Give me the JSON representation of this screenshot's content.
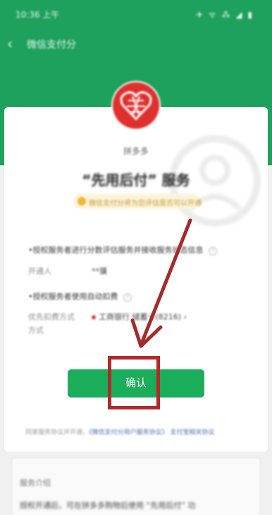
{
  "status_bar": {
    "time": "10:36 上午",
    "icons": "✈ ᯤ ⁂ ◢ ▮"
  },
  "nav": {
    "title": "微信支付分",
    "back_icon": "chevron-left-icon"
  },
  "merchant": {
    "name": "拼多多",
    "logo_icon": "heart-logo-icon"
  },
  "service": {
    "title": "“先用后付” 服务",
    "notice": "微信支付分将为您评估是否可以开通"
  },
  "authorizations": [
    {
      "title": "•授权服务者进行分数评估服务并接收服务状态信息",
      "detail_label": "开通人",
      "detail_value": "**骥"
    },
    {
      "title": "•授权服务者使用自动扣费",
      "detail_label": "优先扣费方式",
      "detail_value": "工商银行 储蓄卡(8216)",
      "detail_extra": "方式"
    }
  ],
  "confirm_button": {
    "label": "确认"
  },
  "agreement": {
    "prefix": "同意服务协议并开通，",
    "link1": "《微信支付分用户服务协议》",
    "link2": "支付宝相关协议"
  },
  "intro": {
    "title": "服务介绍",
    "text": "授权开通后，可在拼多多购物后使用 “先用后付” 功"
  },
  "colors": {
    "header": "#1fa15e",
    "button": "#1aad5a",
    "highlight": "#b02a2a",
    "notice_bg": "#fbf4dc"
  }
}
